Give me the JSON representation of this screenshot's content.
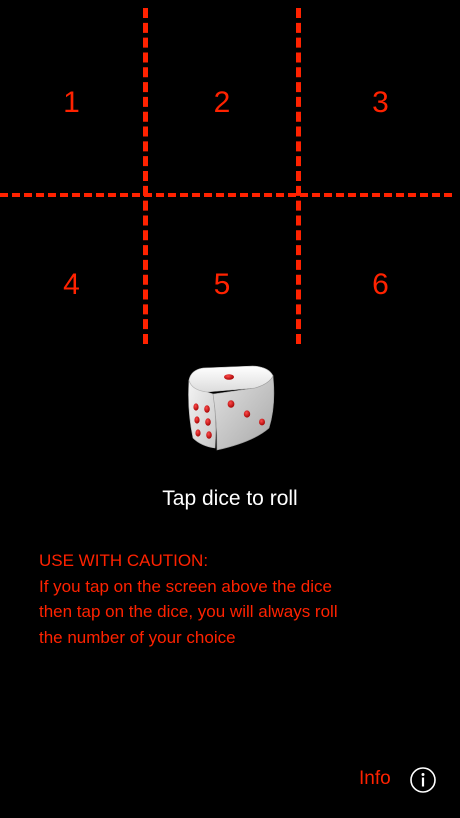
{
  "grid": {
    "cells": [
      "1",
      "2",
      "3",
      "4",
      "5",
      "6"
    ]
  },
  "dice": {
    "icon": "dice-icon"
  },
  "prompt": "Tap dice to roll",
  "caution": {
    "heading": "USE WITH CAUTION:",
    "lines": [
      "If you tap on the screen above the dice",
      "then tap on the dice, you will always roll",
      "the number of your choice"
    ]
  },
  "footer": {
    "info_label": "Info",
    "info_icon": "info-circle-icon"
  },
  "colors": {
    "accent": "#ff2200",
    "background": "#000000",
    "text": "#ffffff"
  }
}
